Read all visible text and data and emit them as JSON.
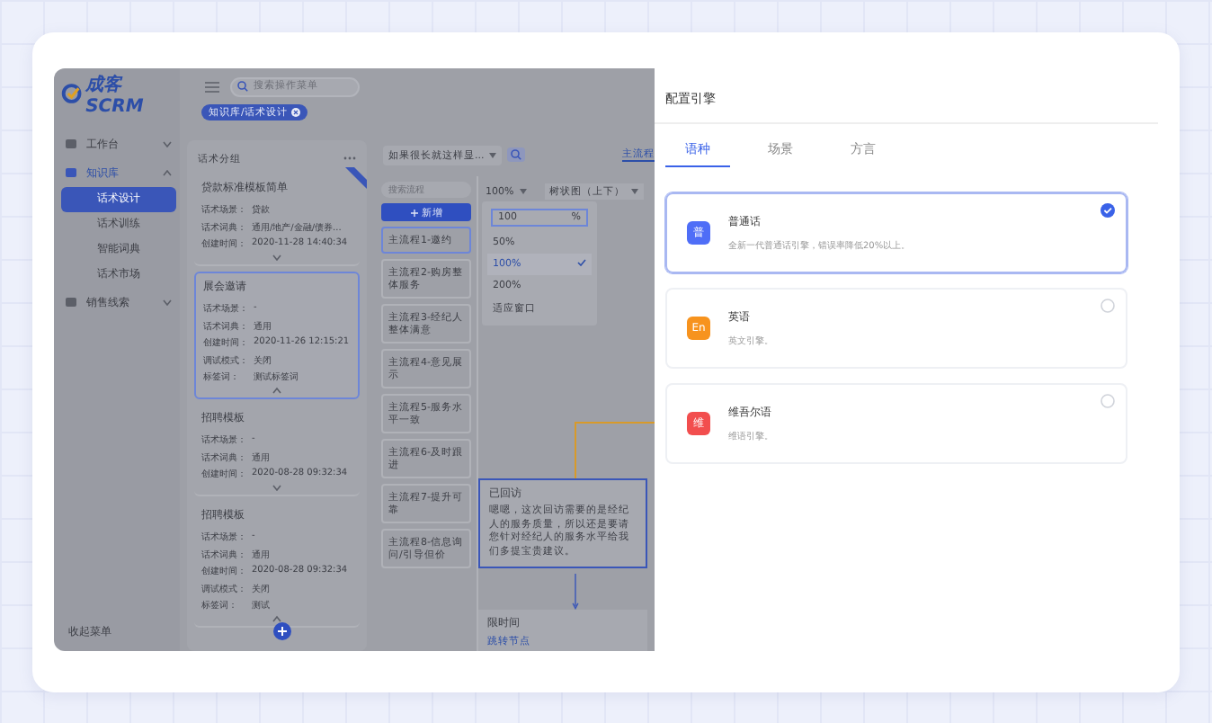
{
  "app": {
    "logo": "成客SCRM",
    "search_placeholder": "搜索操作菜单",
    "breadcrumb_tag": "知识库/话术设计",
    "collapse_label": "收起菜单"
  },
  "sidebar": {
    "items": [
      {
        "label": "工作台",
        "expanded": false
      },
      {
        "label": "知识库",
        "expanded": true,
        "children": [
          {
            "label": "话术设计",
            "selected": true
          },
          {
            "label": "话术训练",
            "selected": false
          },
          {
            "label": "智能词典",
            "selected": false
          },
          {
            "label": "话术市场",
            "selected": false
          }
        ]
      },
      {
        "label": "销售线索",
        "expanded": false
      }
    ]
  },
  "groups": {
    "title": "话术分组",
    "cards": [
      {
        "title": "贷款标准模板简单",
        "ribbon": true,
        "selected": false,
        "expanded": false,
        "fields": [
          {
            "label": "话术场景：",
            "value": "贷款"
          },
          {
            "label": "话术词典：",
            "value": "通用/地产/金融/债券..."
          },
          {
            "label": "创建时间：",
            "value": "2020-11-28 14:40:34"
          }
        ]
      },
      {
        "title": "展会邀请",
        "ribbon": false,
        "selected": true,
        "expanded": true,
        "fields": [
          {
            "label": "话术场景：",
            "value": "-"
          },
          {
            "label": "话术词典：",
            "value": "通用"
          },
          {
            "label": "创建时间：",
            "value": "2020-11-26 12:15:21"
          },
          {
            "label": "调试模式：",
            "value": "关闭"
          },
          {
            "label": "标签词：",
            "value": "测试标签词"
          }
        ]
      },
      {
        "title": "招聘模板",
        "ribbon": false,
        "selected": false,
        "expanded": false,
        "fields": [
          {
            "label": "话术场景：",
            "value": "-"
          },
          {
            "label": "话术词典：",
            "value": "通用"
          },
          {
            "label": "创建时间：",
            "value": "2020-08-28 09:32:34"
          }
        ]
      },
      {
        "title": "招聘模板",
        "ribbon": false,
        "selected": false,
        "expanded": true,
        "fields": [
          {
            "label": "话术场景：",
            "value": "-"
          },
          {
            "label": "话术词典：",
            "value": "通用"
          },
          {
            "label": "创建时间：",
            "value": "2020-08-28 09:32:34"
          },
          {
            "label": "调试模式：",
            "value": "关闭"
          },
          {
            "label": "标签词：",
            "value": "测试"
          }
        ]
      }
    ]
  },
  "flow": {
    "selector": "如果很长就这样显...",
    "tab": "主流程",
    "search_placeholder": "搜索流程",
    "add_button": "新增",
    "items": [
      {
        "label": "主流程1-邀约",
        "selected": true
      },
      {
        "label": "主流程2-购房整体服务",
        "selected": false
      },
      {
        "label": "主流程3-经纪人整体满意",
        "selected": false
      },
      {
        "label": "主流程4-意见展示",
        "selected": false
      },
      {
        "label": "主流程5-服务水平一致",
        "selected": false
      },
      {
        "label": "主流程6-及时跟进",
        "selected": false
      },
      {
        "label": "主流程7-提升可靠",
        "selected": false
      },
      {
        "label": "主流程8-信息询问/引导但价",
        "selected": false
      }
    ],
    "zoom": "100%",
    "layout": "树状图（上下）",
    "zoom_menu": {
      "input": "100",
      "unit": "%",
      "options": [
        {
          "label": "50%",
          "selected": false
        },
        {
          "label": "100%",
          "selected": true
        },
        {
          "label": "200%",
          "selected": false
        },
        {
          "label": "适应窗口",
          "selected": false
        }
      ]
    },
    "nodes": [
      {
        "title": "已回访",
        "text": "嗯嗯，这次回访需要的是经纪人的服务质量，所以还是要请您针对经纪人的服务水平给我们多提宝贵建议。"
      },
      {
        "title": "限时间",
        "text": "跳转节点"
      }
    ]
  },
  "drawer": {
    "title": "配置引擎",
    "tabs": [
      {
        "label": "语种",
        "selected": true
      },
      {
        "label": "场景",
        "selected": false
      },
      {
        "label": "方言",
        "selected": false
      }
    ],
    "engines": [
      {
        "icon": "普",
        "color": "#4f6ef7",
        "name": "普通话",
        "desc": "全新一代普通话引擎，错误率降低20%以上。",
        "selected": true
      },
      {
        "icon": "En",
        "color": "#f7931e",
        "name": "英语",
        "desc": "英文引擎。",
        "selected": false
      },
      {
        "icon": "维",
        "color": "#f24e4e",
        "name": "维吾尔语",
        "desc": "维语引擎。",
        "selected": false
      }
    ]
  }
}
